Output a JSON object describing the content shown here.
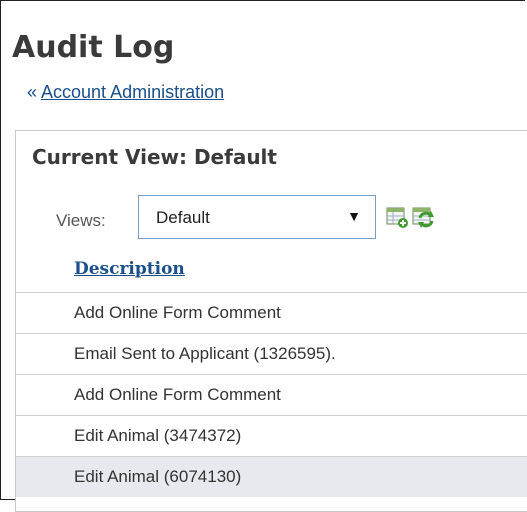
{
  "header": {
    "title": "Audit Log",
    "breadcrumb_arrow": "«",
    "breadcrumb_link": "Account Administration"
  },
  "panel": {
    "title": "Current View: Default",
    "views_label": "Views:",
    "views_selected": "Default",
    "caret": "▼",
    "icons": [
      "add-view-icon",
      "refresh-view-icon"
    ],
    "column_header": "Description",
    "rows": [
      "Add Online Form Comment",
      "Email Sent to Applicant (1326595).",
      "Add Online Form Comment",
      "Edit Animal (3474372)",
      "Edit Animal (6074130)"
    ]
  },
  "colors": {
    "link": "#1a4f8c",
    "title": "#3a3a3a",
    "row_highlight": "#e8e9ee",
    "select_border": "#7a9ccf"
  }
}
